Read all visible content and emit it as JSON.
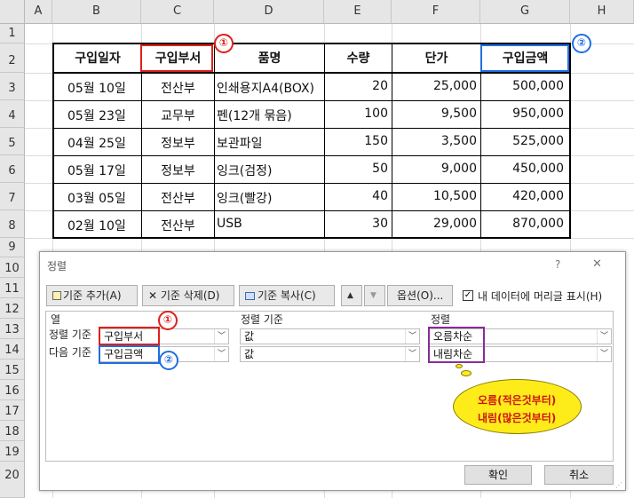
{
  "sheet": {
    "columns": [
      "A",
      "B",
      "C",
      "D",
      "E",
      "F",
      "G",
      "H"
    ],
    "rows": [
      "1",
      "2",
      "3",
      "4",
      "5",
      "6",
      "7",
      "8",
      "9",
      "10",
      "11",
      "12",
      "13",
      "14",
      "15",
      "16",
      "17",
      "18",
      "19",
      "20"
    ],
    "headers": [
      "구입일자",
      "구입부서",
      "품명",
      "수량",
      "단가",
      "구입금액"
    ],
    "data": [
      [
        "05월 10일",
        "전산부",
        "인쇄용지A4(BOX)",
        "20",
        "25,000",
        "500,000"
      ],
      [
        "05월 23일",
        "교무부",
        "펜(12개 묶음)",
        "100",
        "9,500",
        "950,000"
      ],
      [
        "04월 25일",
        "정보부",
        "보관파일",
        "150",
        "3,500",
        "525,000"
      ],
      [
        "05월 17일",
        "정보부",
        "잉크(검정)",
        "50",
        "9,000",
        "450,000"
      ],
      [
        "03월 05일",
        "전산부",
        "잉크(빨강)",
        "40",
        "10,500",
        "420,000"
      ],
      [
        "02월 10일",
        "전산부",
        "USB",
        "30",
        "29,000",
        "870,000"
      ]
    ],
    "marker1": "①",
    "marker2": "②"
  },
  "dialog": {
    "title": "정렬",
    "help": "?",
    "close": "✕",
    "add_level": "기준 추가(A)",
    "delete_level": "기준 삭제(D)",
    "copy_level": "기준 복사(C)",
    "up": "▲",
    "down": "▼",
    "options": "옵션(O)...",
    "header_checkbox": "내 데이터에 머리글 표시(H)",
    "col_header": "열",
    "sort_on_header": "정렬 기준",
    "order_header": "정렬",
    "row1_label": "정렬 기준",
    "row2_label": "다음 기준",
    "row1_column": "구입부서",
    "row2_column": "구입금액",
    "row1_sorton": "값",
    "row2_sorton": "값",
    "row1_order": "오름차순",
    "row2_order": "내림차순",
    "ok": "확인",
    "cancel": "취소"
  },
  "callout": {
    "line1": "오름(적은것부터)",
    "line2": "내림(많은것부터)"
  }
}
